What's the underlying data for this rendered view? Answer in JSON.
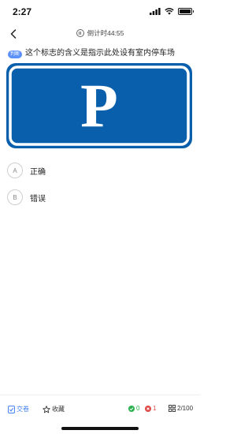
{
  "status_bar": {
    "time": "2:27"
  },
  "nav": {
    "timer_label": "倒计时44:55"
  },
  "question": {
    "type_badge": "判断",
    "text": "这个标志的含义是指示此处设有室内停车场"
  },
  "sign": {
    "letter": "P",
    "background": "#0a5fad",
    "foreground": "#ffffff"
  },
  "options": [
    {
      "key": "A",
      "label": "正确"
    },
    {
      "key": "B",
      "label": "错误"
    }
  ],
  "bottom_bar": {
    "submit_label": "交卷",
    "favorite_label": "收藏",
    "correct_count": "0",
    "wrong_count": "1",
    "progress": "2/100"
  },
  "colors": {
    "accent": "#3f7cf5",
    "correct": "#2bb14e",
    "wrong": "#e04848"
  }
}
